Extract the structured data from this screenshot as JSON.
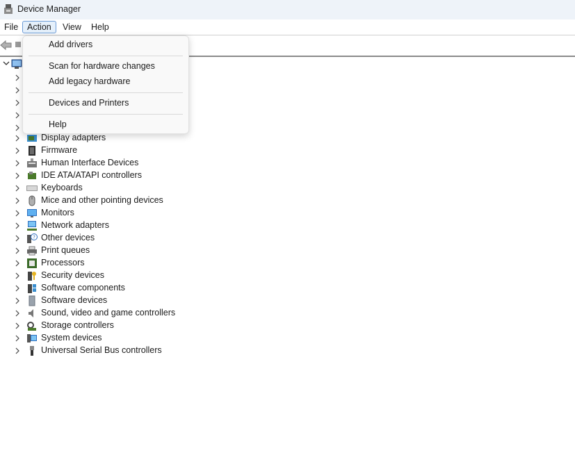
{
  "window": {
    "title": "Device Manager"
  },
  "menubar": {
    "items": [
      "File",
      "Action",
      "View",
      "Help"
    ]
  },
  "action_menu": {
    "items": [
      "Add drivers",
      "Scan for hardware changes",
      "Add legacy hardware",
      "Devices and Printers",
      "Help"
    ]
  },
  "tree": {
    "categories": [
      {
        "label": "Display adapters",
        "icon": "display-adapter-icon"
      },
      {
        "label": "Firmware",
        "icon": "firmware-icon"
      },
      {
        "label": "Human Interface Devices",
        "icon": "hid-icon"
      },
      {
        "label": "IDE ATA/ATAPI controllers",
        "icon": "ide-controller-icon"
      },
      {
        "label": "Keyboards",
        "icon": "keyboard-icon"
      },
      {
        "label": "Mice and other pointing devices",
        "icon": "mouse-icon"
      },
      {
        "label": "Monitors",
        "icon": "monitor-icon"
      },
      {
        "label": "Network adapters",
        "icon": "network-adapter-icon"
      },
      {
        "label": "Other devices",
        "icon": "other-devices-icon"
      },
      {
        "label": "Print queues",
        "icon": "printer-icon"
      },
      {
        "label": "Processors",
        "icon": "processor-icon"
      },
      {
        "label": "Security devices",
        "icon": "security-device-icon"
      },
      {
        "label": "Software components",
        "icon": "software-component-icon"
      },
      {
        "label": "Software devices",
        "icon": "software-device-icon"
      },
      {
        "label": "Sound, video and game controllers",
        "icon": "sound-icon"
      },
      {
        "label": "Storage controllers",
        "icon": "storage-controller-icon"
      },
      {
        "label": "System devices",
        "icon": "system-devices-icon"
      },
      {
        "label": "Universal Serial Bus controllers",
        "icon": "usb-icon"
      }
    ]
  },
  "colors": {
    "accent": "#6a9ad6",
    "titlebar": "#eef3f9",
    "menu_bg": "#f9f9f9"
  }
}
